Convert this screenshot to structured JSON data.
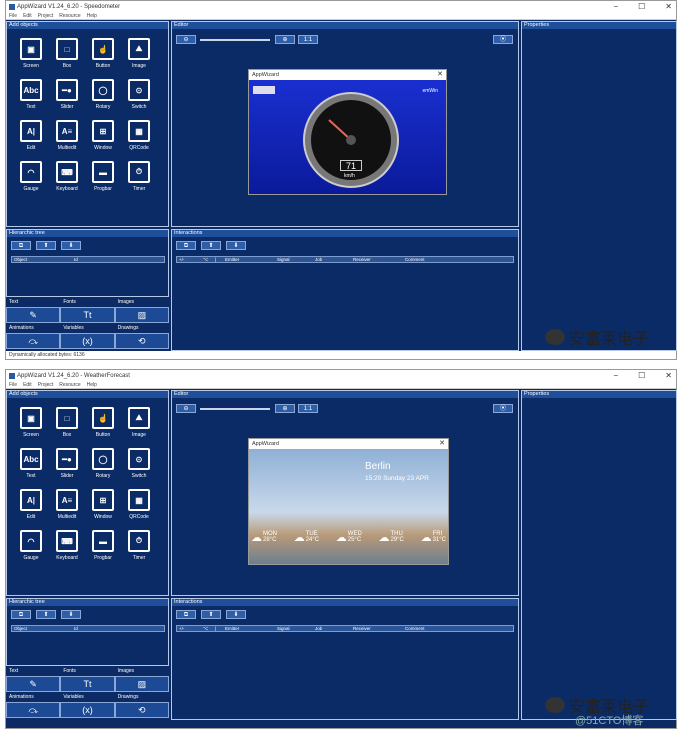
{
  "windows": [
    {
      "title": "AppWizard V1.24_6.20 - Speedometer",
      "menu": [
        "File",
        "Edit",
        "Project",
        "Resource",
        "Help"
      ],
      "panels": {
        "add_objects": "Add objects",
        "editor": "Editor",
        "properties": "Properties",
        "hierarchic_tree": "Hierarchic tree",
        "interactions": "Interactions"
      },
      "objects": [
        "Screen",
        "Box",
        "Button",
        "Image",
        "Text",
        "Slider",
        "Rotary",
        "Switch",
        "Edit",
        "Multiedit",
        "Window",
        "QRCode",
        "Gauge",
        "Keyboard",
        "Progbar",
        "Timer"
      ],
      "zoom_label": "1:1",
      "tree_cols": [
        "Object",
        "Id"
      ],
      "inter_cols": [
        "+/-",
        "",
        "⌥",
        "|",
        "Emitter",
        "Signal",
        "Job",
        "Receiver",
        "Comment"
      ],
      "tabs_row1": [
        "Text",
        "Fonts",
        "Images"
      ],
      "tabs_row2": [
        "Animations",
        "Variables",
        "Drawings"
      ],
      "status": "Dynamically allocated bytes: 6136",
      "dialog_title": "AppWizard",
      "speed": {
        "unit": "km/h",
        "value": "71",
        "brand": "emWin"
      }
    },
    {
      "title": "AppWizard V1.24_6.20 - WeatherForecast",
      "menu": [
        "File",
        "Edit",
        "Project",
        "Resource",
        "Help"
      ],
      "panels": {
        "add_objects": "Add objects",
        "editor": "Editor",
        "properties": "Properties",
        "hierarchic_tree": "Hierarchic tree",
        "interactions": "Interactions"
      },
      "objects": [
        "Screen",
        "Box",
        "Button",
        "Image",
        "Text",
        "Slider",
        "Rotary",
        "Switch",
        "Edit",
        "Multiedit",
        "Window",
        "QRCode",
        "Gauge",
        "Keyboard",
        "Progbar",
        "Timer"
      ],
      "zoom_label": "1:1",
      "tree_cols": [
        "Object",
        "Id"
      ],
      "inter_cols": [
        "+/-",
        "",
        "⌥",
        "|",
        "Emitter",
        "Signal",
        "Job",
        "Receiver",
        "Comment"
      ],
      "tabs_row1": [
        "Text",
        "Fonts",
        "Images"
      ],
      "tabs_row2": [
        "Animations",
        "Variables",
        "Drawings"
      ],
      "dialog_title": "AppWizard",
      "weather": {
        "city": "Berlin",
        "datetime": "15:20 Sunday 23 APR",
        "days": [
          {
            "day": "MON",
            "temp": "28°C"
          },
          {
            "day": "TUE",
            "temp": "24°C"
          },
          {
            "day": "WED",
            "temp": "25°C"
          },
          {
            "day": "THU",
            "temp": "29°C"
          },
          {
            "day": "FRI",
            "temp": "31°C"
          }
        ]
      }
    }
  ],
  "watermark": {
    "text": "安富莱电子",
    "site": "@51CTO博客"
  }
}
